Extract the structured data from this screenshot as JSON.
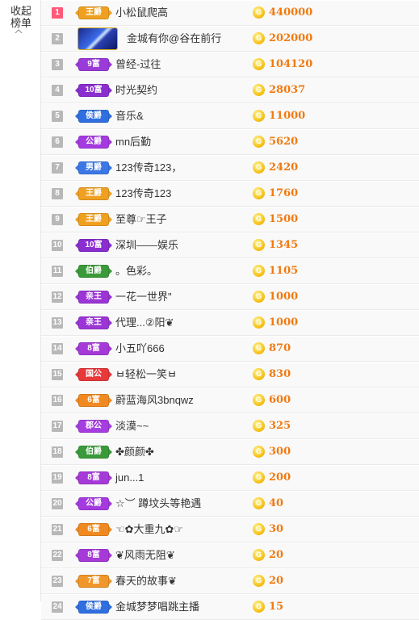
{
  "sidebar": {
    "collapse_label": "收起榜单",
    "collapse_icon": "chevron-up-icon"
  },
  "ranking": [
    {
      "rank": "1",
      "badge": "王爵",
      "badge_color": "#f0a020",
      "name": "小松鼠爬高",
      "value": "440000"
    },
    {
      "rank": "2",
      "badge": "",
      "badge_color": "#2a52d0",
      "name": "金城有你@谷在前行",
      "value": "202000",
      "avatar": true
    },
    {
      "rank": "3",
      "badge": "9富",
      "badge_color": "#9a3ad8",
      "name": "曾经-过往",
      "value": "104120"
    },
    {
      "rank": "4",
      "badge": "10富",
      "badge_color": "#8a2ed0",
      "name": "时光契约",
      "value": "28037"
    },
    {
      "rank": "5",
      "badge": "侯爵",
      "badge_color": "#2f6fe0",
      "name": "音乐&",
      "value": "11000"
    },
    {
      "rank": "6",
      "badge": "公爵",
      "badge_color": "#a43ae0",
      "name": "mn后勤",
      "value": "5620"
    },
    {
      "rank": "7",
      "badge": "男爵",
      "badge_color": "#3b78e6",
      "name": "123传奇123，",
      "value": "2420"
    },
    {
      "rank": "8",
      "badge": "王爵",
      "badge_color": "#f0a020",
      "name": "123传奇123",
      "value": "1760"
    },
    {
      "rank": "9",
      "badge": "王爵",
      "badge_color": "#f0a020",
      "name": "至尊☞王子",
      "value": "1500"
    },
    {
      "rank": "10",
      "badge": "10富",
      "badge_color": "#8a2ed0",
      "name": "深圳——娱乐",
      "value": "1345"
    },
    {
      "rank": "11",
      "badge": "伯爵",
      "badge_color": "#3a9a3a",
      "name": "。色彩。",
      "value": "1105"
    },
    {
      "rank": "12",
      "badge": "亲王",
      "badge_color": "#9b35d6",
      "name": "一花一世界\"",
      "value": "1000"
    },
    {
      "rank": "13",
      "badge": "亲王",
      "badge_color": "#9b35d6",
      "name": "代理...②阳❦",
      "value": "1000"
    },
    {
      "rank": "14",
      "badge": "8富",
      "badge_color": "#a53ad8",
      "name": "小五吖666",
      "value": "870"
    },
    {
      "rank": "15",
      "badge": "国公",
      "badge_color": "#e8383a",
      "name": "ㅂ轻松一笑ㅂ",
      "value": "830"
    },
    {
      "rank": "16",
      "badge": "6富",
      "badge_color": "#f08a20",
      "name": "蔚蓝海风3bnqwz",
      "value": "600"
    },
    {
      "rank": "17",
      "badge": "郡公",
      "badge_color": "#a63de0",
      "name": "淡漠~~",
      "value": "325"
    },
    {
      "rank": "18",
      "badge": "伯爵",
      "badge_color": "#3a9a3a",
      "name": "✤颜颜✤",
      "value": "300"
    },
    {
      "rank": "19",
      "badge": "8富",
      "badge_color": "#a53ad8",
      "name": "jun...1",
      "value": "200"
    },
    {
      "rank": "20",
      "badge": "公爵",
      "badge_color": "#a43ae0",
      "name": "☆︶ 蹲坟头等艳遇",
      "value": "40"
    },
    {
      "rank": "21",
      "badge": "6富",
      "badge_color": "#f08a20",
      "name": "☜✿大重九✿☞",
      "value": "30"
    },
    {
      "rank": "22",
      "badge": "8富",
      "badge_color": "#a53ad8",
      "name": "❦风雨无阻❦",
      "value": "20"
    },
    {
      "rank": "23",
      "badge": "7富",
      "badge_color": "#f0962a",
      "name": "春天的故事❦",
      "value": "20"
    },
    {
      "rank": "24",
      "badge": "侯爵",
      "badge_color": "#2f6fe0",
      "name": "金城梦梦唱跳主播",
      "value": "15"
    }
  ],
  "coin_glyph": "G"
}
